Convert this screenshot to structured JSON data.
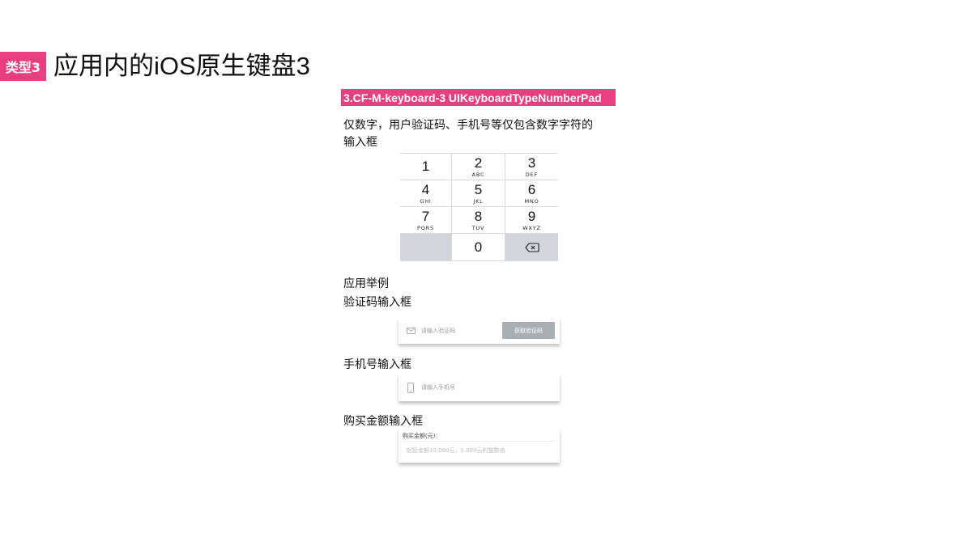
{
  "header": {
    "badge": "类型3",
    "title": "应用内的iOS原生键盘3"
  },
  "banner": {
    "label": "3.CF-M-keyboard-3 UIKeyboardTypeNumberPad"
  },
  "description": {
    "line1": "仅数字，用户验证码、手机号等仅包含数字字符的",
    "line2": "输入框"
  },
  "numpad": {
    "keys": [
      {
        "digit": "1",
        "letters": ""
      },
      {
        "digit": "2",
        "letters": "ABC"
      },
      {
        "digit": "3",
        "letters": "DEF"
      },
      {
        "digit": "4",
        "letters": "GHI"
      },
      {
        "digit": "5",
        "letters": "JKL"
      },
      {
        "digit": "6",
        "letters": "MNO"
      },
      {
        "digit": "7",
        "letters": "PQRS"
      },
      {
        "digit": "8",
        "letters": "TUV"
      },
      {
        "digit": "9",
        "letters": "WXYZ"
      },
      {
        "digit": "0",
        "letters": ""
      }
    ],
    "delete_icon": "backspace-icon"
  },
  "examples": {
    "heading": "应用举例",
    "verification": {
      "label": "验证码输入框",
      "placeholder": "请输入验证码",
      "button": "获取验证码",
      "icon": "envelope-icon"
    },
    "phone": {
      "label": "手机号输入框",
      "placeholder": "请输入手机号",
      "icon": "phone-icon"
    },
    "amount": {
      "label": "购买金额输入框",
      "field_title": "购买金额(元)：",
      "placeholder": "起投金额10,000元，1,000元的整数倍"
    }
  }
}
